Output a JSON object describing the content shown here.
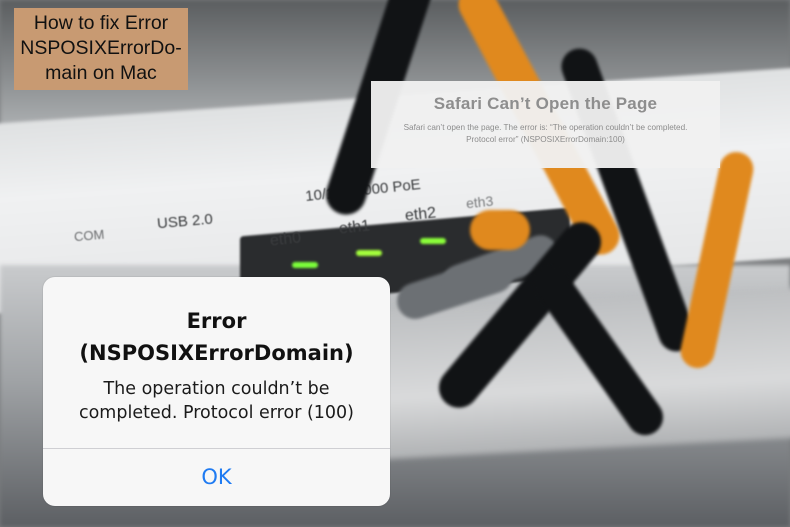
{
  "title_badge": {
    "lines": [
      "How to fix Error",
      "NSPOSIXErrorDo-",
      "main on Mac"
    ],
    "background": "#c89a72"
  },
  "background_labels": {
    "poe": "10/100/1000 PoE",
    "usb": "USB 2.0",
    "com": "COM",
    "eth0": "eth0",
    "eth1": "eth1",
    "eth2": "eth2",
    "eth3": "eth3"
  },
  "safari_dialog": {
    "title": "Safari Can’t Open the Page",
    "message_line1": "Safari can’t open the page. The error is: “The operation couldn’t be completed.",
    "message_line2": "Protocol error” (NSPOSIXErrorDomain:100)"
  },
  "ios_alert": {
    "title_line1": "Error",
    "title_line2": "(NSPOSIXErrorDomain)",
    "message_line1": "The operation couldn’t be",
    "message_line2": "completed. Protocol error (100)",
    "ok_label": "OK",
    "button_color": "#1f7bf2"
  }
}
